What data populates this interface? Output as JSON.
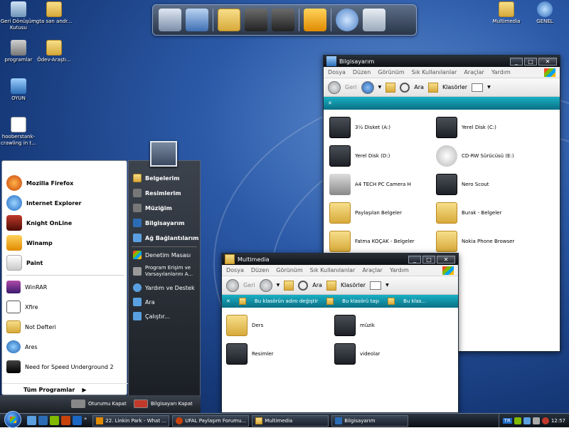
{
  "desktop_icons": [
    {
      "label": "Geri Dönüşüm Kutusu",
      "icon": "recycle-bin-icon"
    },
    {
      "label": "gta san andr...",
      "icon": "folder-icon"
    },
    {
      "label": "programlar",
      "icon": "programs-icon"
    },
    {
      "label": "Ödev-Araştı...",
      "icon": "folder-icon"
    },
    {
      "label": "OYUN",
      "icon": "computer-icon"
    },
    {
      "label": "hooberstank-crawling in t...",
      "icon": "document-icon"
    },
    {
      "label": "Multimedia",
      "icon": "folder-icon"
    },
    {
      "label": "GENEL",
      "icon": "globe-icon"
    }
  ],
  "dock": {
    "icons": [
      "network-icon",
      "library-icon",
      "music-folder-icon",
      "pictures-folder-icon",
      "video-folder-icon",
      "winamp-icon",
      "settings-icon",
      "recycle-bin-icon"
    ]
  },
  "window_computer": {
    "title": "Bilgisayarım",
    "menu": [
      "Dosya",
      "Düzen",
      "Görünüm",
      "Sık Kullanılanlar",
      "Araçlar",
      "Yardım"
    ],
    "toolbar": {
      "back": "Geri",
      "search": "Ara",
      "folders": "Klasörler"
    },
    "items": [
      {
        "label": "3½ Disket (A:)",
        "icon": "floppy-icon"
      },
      {
        "label": "Yerel Disk (C:)",
        "icon": "hard-drive-icon"
      },
      {
        "label": "Yerel Disk (D:)",
        "icon": "hard-drive-icon"
      },
      {
        "label": "CD-RW Sürücüsü (E:)",
        "icon": "cd-drive-icon"
      },
      {
        "label": "A4 TECH PC Camera H",
        "icon": "camera-icon"
      },
      {
        "label": "Nero Scout",
        "icon": "nero-icon"
      },
      {
        "label": "Paylaşılan Belgeler",
        "icon": "folder-icon"
      },
      {
        "label": "Burak - Belgeler",
        "icon": "folder-icon"
      },
      {
        "label": "Fatma KOÇAK - Belgeler",
        "icon": "folder-icon"
      },
      {
        "label": "Nokia Phone Browser",
        "icon": "nokia-icon"
      }
    ]
  },
  "window_multimedia": {
    "title": "Multimedia",
    "menu": [
      "Dosya",
      "Düzen",
      "Görünüm",
      "Sık Kullanılanlar",
      "Araçlar",
      "Yardım"
    ],
    "toolbar": {
      "back": "Geri",
      "search": "Ara",
      "folders": "Klasörler"
    },
    "tasks": [
      "Bu klasörün adını değiştir",
      "Bu klasörü taşı",
      "Bu klas..."
    ],
    "items": [
      {
        "label": "Ders",
        "icon": "folder-icon"
      },
      {
        "label": "müzik",
        "icon": "music-folder-icon"
      },
      {
        "label": "Resimler",
        "icon": "pictures-folder-icon"
      },
      {
        "label": "videolar",
        "icon": "video-folder-icon"
      }
    ]
  },
  "start_menu": {
    "pinned": [
      {
        "label": "Mozilla Firefox",
        "icon": "firefox-icon"
      },
      {
        "label": "Internet Explorer",
        "icon": "ie-icon"
      },
      {
        "label": "Knight OnLine",
        "icon": "knight-online-icon"
      },
      {
        "label": "Winamp",
        "icon": "winamp-icon"
      },
      {
        "label": "Paint",
        "icon": "paint-icon"
      }
    ],
    "recent": [
      {
        "label": "WinRAR",
        "icon": "winrar-icon"
      },
      {
        "label": "Xfire",
        "icon": "xfire-icon"
      },
      {
        "label": "Not Defteri",
        "icon": "notepad-icon"
      },
      {
        "label": "Ares",
        "icon": "ares-icon"
      },
      {
        "label": "Need for Speed Underground 2",
        "icon": "nfs-icon"
      }
    ],
    "all_programs": "Tüm Programlar",
    "right": [
      {
        "label": "Belgelerim",
        "icon": "documents-icon",
        "bold": true
      },
      {
        "label": "Resimlerim",
        "icon": "pictures-icon",
        "bold": true
      },
      {
        "label": "Müziğim",
        "icon": "music-icon",
        "bold": true
      },
      {
        "label": "Bilgisayarım",
        "icon": "computer-icon",
        "bold": true
      },
      {
        "label": "Ağ Bağlantılarım",
        "icon": "network-icon",
        "bold": true
      },
      {
        "label": "Denetim Masası",
        "icon": "control-panel-icon",
        "bold": false
      },
      {
        "label": "Program Erişim ve Varsayılanlarını A...",
        "icon": "defaults-icon",
        "bold": false
      },
      {
        "label": "Yardım ve Destek",
        "icon": "help-icon",
        "bold": false
      },
      {
        "label": "Ara",
        "icon": "search-icon",
        "bold": false
      },
      {
        "label": "Çalıştır...",
        "icon": "run-icon",
        "bold": false
      }
    ],
    "logoff": "Oturumu Kapat",
    "shutdown": "Bilgisayarı Kapat"
  },
  "taskbar": {
    "tasks": [
      {
        "label": "22. Linkin Park - What ...",
        "icon": "winamp-icon"
      },
      {
        "label": "UFAL Paylaşım Forumu...",
        "icon": "firefox-icon"
      },
      {
        "label": "Multimedia",
        "icon": "folder-icon"
      },
      {
        "label": "Bilgisayarım",
        "icon": "computer-icon"
      }
    ],
    "lang": "TR",
    "clock": "12:57"
  }
}
